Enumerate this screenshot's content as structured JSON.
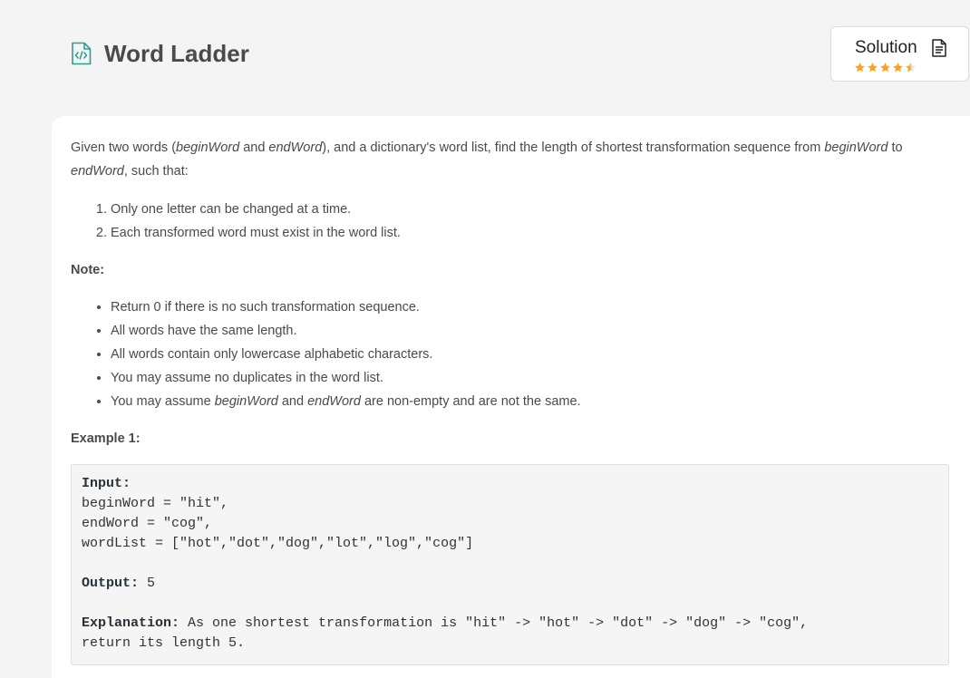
{
  "header": {
    "title": "Word Ladder",
    "title_icon": "code-file-icon",
    "accent_color": "#2e9e94"
  },
  "solution": {
    "label": "Solution",
    "icon": "document-icon",
    "rating": 4.5,
    "star_color": "#ffa116"
  },
  "problem": {
    "intro": {
      "t1": "Given two words (",
      "begin": "beginWord",
      "t2": " and ",
      "end": "endWord",
      "t3": "), and a dictionary's word list, find the length of shortest transformation sequence from ",
      "begin2": "beginWord",
      "t4": " to ",
      "end2": "endWord",
      "t5": ", such that:"
    },
    "rules": [
      "Only one letter can be changed at a time.",
      "Each transformed word must exist in the word list."
    ],
    "note_label": "Note:",
    "notes": [
      "Return 0 if there is no such transformation sequence.",
      "All words have the same length.",
      "All words contain only lowercase alphabetic characters.",
      "You may assume no duplicates in the word list."
    ],
    "last_note": {
      "t1": "You may assume ",
      "begin": "beginWord",
      "t2": " and ",
      "end": "endWord",
      "t3": " are non-empty and are not the same."
    },
    "example_label": "Example 1:",
    "example": {
      "input_label": "Input:",
      "input_lines": [
        "beginWord = \"hit\",",
        "endWord = \"cog\",",
        "wordList = [\"hot\",\"dot\",\"dog\",\"lot\",\"log\",\"cog\"]"
      ],
      "output_label": "Output:",
      "output_value": " 5",
      "explanation_label": "Explanation:",
      "explanation_line1": " As one shortest transformation is \"hit\" -> \"hot\" -> \"dot\" -> \"dog\" -> \"cog\",",
      "explanation_line2": "return its length 5."
    }
  }
}
